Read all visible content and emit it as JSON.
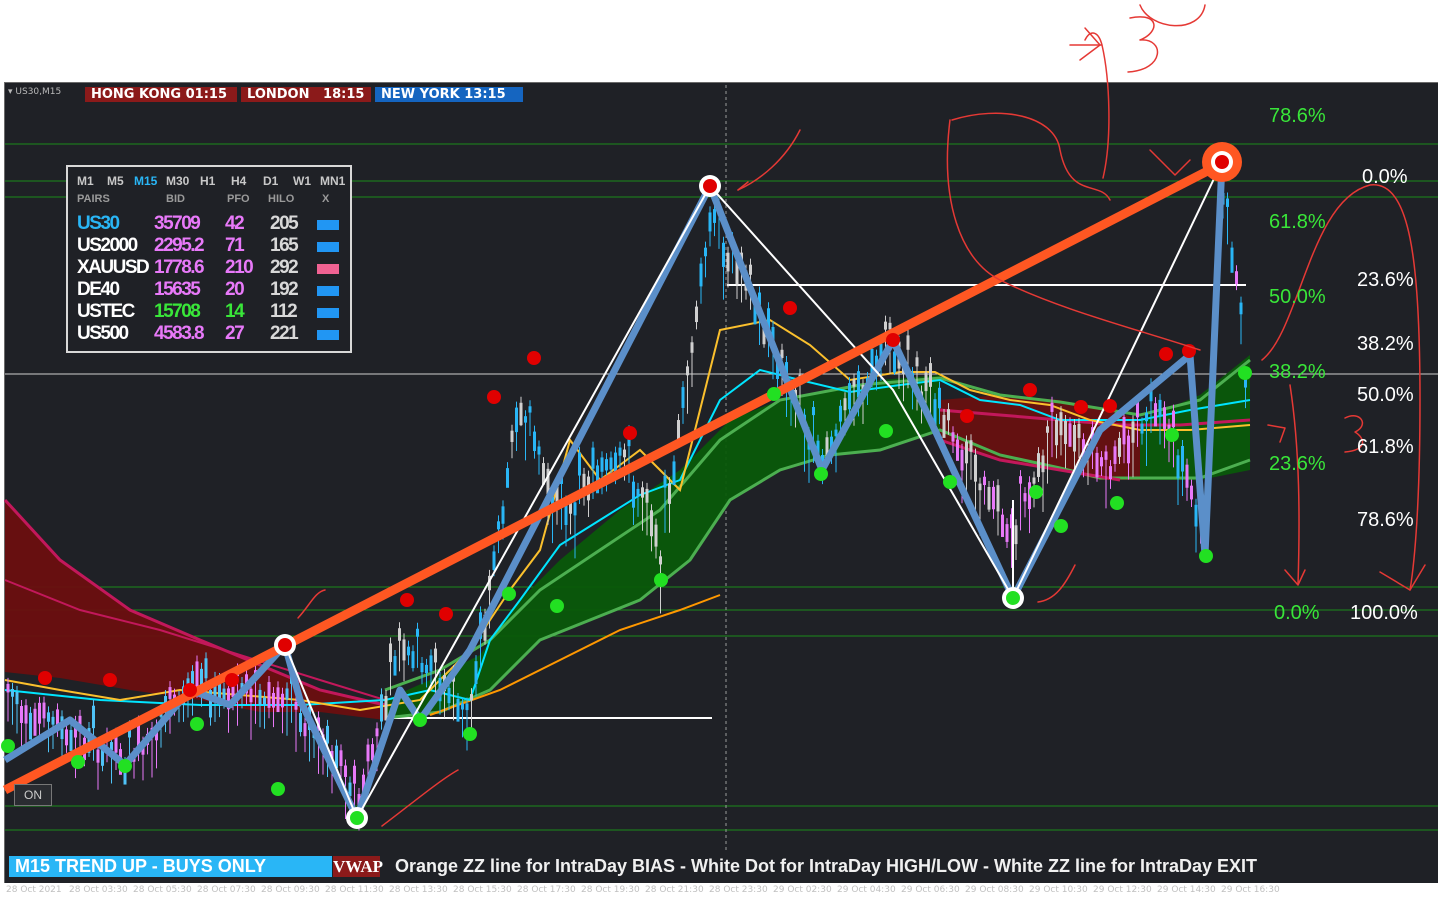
{
  "chart": {
    "symbol": "US30,M15",
    "on_button": "ON"
  },
  "sessions": [
    {
      "label": "HONG KONG 01:15",
      "color": "#8b1a1a"
    },
    {
      "label": "LONDON   18:15",
      "color": "#8b1a1a"
    },
    {
      "label": "NEW YORK 13:15",
      "color": "#1565c0"
    }
  ],
  "dashboard": {
    "timeframes": [
      "M1",
      "M5",
      "M15",
      "M30",
      "H1",
      "H4",
      "D1",
      "W1",
      "MN1"
    ],
    "active_timeframe": "M15",
    "headers": [
      "PAIRS",
      "BID",
      "PFO",
      "HILO",
      "X"
    ],
    "rows": [
      {
        "pair": "US30",
        "bid": "35709",
        "pfo": "42",
        "hilo": "205",
        "x_color": "#2196f3"
      },
      {
        "pair": "US2000",
        "bid": "2295.2",
        "pfo": "71",
        "hilo": "165",
        "x_color": "#2196f3"
      },
      {
        "pair": "XAUUSD",
        "bid": "1778.6",
        "pfo": "210",
        "hilo": "292",
        "x_color": "#f06292"
      },
      {
        "pair": "DE40",
        "bid": "15635",
        "pfo": "20",
        "hilo": "192",
        "x_color": "#2196f3"
      },
      {
        "pair": "USTEC",
        "bid": "15708",
        "pfo": "14",
        "hilo": "112",
        "x_color": "#2196f3"
      },
      {
        "pair": "US500",
        "bid": "4583.8",
        "pfo": "27",
        "hilo": "221",
        "x_color": "#2196f3"
      }
    ]
  },
  "fib_green": [
    "78.6%",
    "61.8%",
    "50.0%",
    "38.2%",
    "23.6%",
    "0.0%"
  ],
  "fib_white": [
    "0.0%",
    "23.6%",
    "38.2%",
    "50.0%",
    "61.8%",
    "78.6%",
    "100.0%"
  ],
  "status": "M15 TREND UP - BUYS ONLY",
  "vwap": "VWAP",
  "ticker": "Orange ZZ line for IntraDay BIAS - White Dot for IntraDay HIGH/LOW - White ZZ line for IntraDay EXIT",
  "dates": [
    "28 Oct 2021",
    "28 Oct 03:30",
    "28 Oct 05:30",
    "28 Oct 07:30",
    "28 Oct 09:30",
    "28 Oct 11:30",
    "28 Oct 13:30",
    "28 Oct 15:30",
    "28 Oct 17:30",
    "28 Oct 19:30",
    "28 Oct 21:30",
    "28 Oct 23:30",
    "29 Oct 02:30",
    "29 Oct 04:30",
    "29 Oct 06:30",
    "29 Oct 08:30",
    "29 Oct 10:30",
    "29 Oct 12:30",
    "29 Oct 14:30",
    "29 Oct 16:30"
  ],
  "handwritten_note": "3",
  "colors": {
    "background": "#1f2126",
    "grid_green": "#1b8a1b",
    "orange_zz": "#ff5722",
    "blue_zz": "#5b8fc9",
    "white_zz": "#ffffff",
    "bull_fill": "#0a5a0a",
    "bear_fill": "#6b0f0f",
    "ink": "#e53935",
    "dot_red": "#e00000",
    "dot_green": "#22e022"
  }
}
